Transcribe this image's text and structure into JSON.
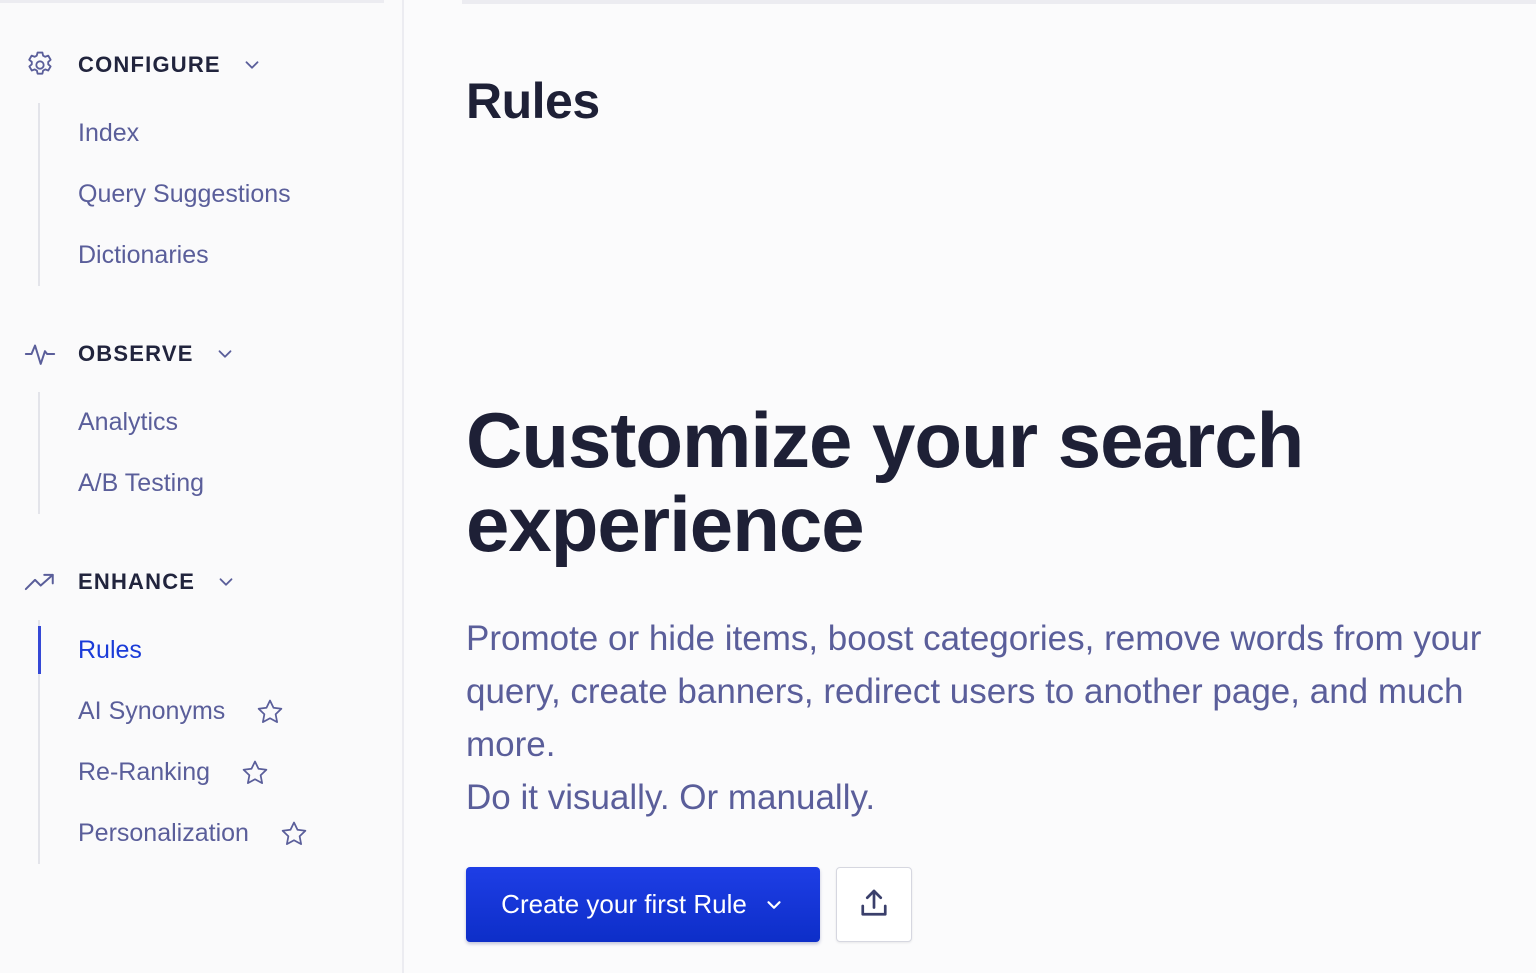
{
  "sidebar": {
    "sections": [
      {
        "title": "CONFIGURE",
        "icon": "gear-icon",
        "items": [
          {
            "label": "Index"
          },
          {
            "label": "Query Suggestions"
          },
          {
            "label": "Dictionaries"
          }
        ]
      },
      {
        "title": "OBSERVE",
        "icon": "pulse-icon",
        "items": [
          {
            "label": "Analytics"
          },
          {
            "label": "A/B Testing"
          }
        ]
      },
      {
        "title": "ENHANCE",
        "icon": "trending-up-icon",
        "items": [
          {
            "label": "Rules",
            "active": true
          },
          {
            "label": "AI Synonyms",
            "starred_icon": "star-icon"
          },
          {
            "label": "Re-Ranking",
            "starred_icon": "star-icon"
          },
          {
            "label": "Personalization",
            "starred_icon": "star-icon"
          }
        ]
      }
    ]
  },
  "main": {
    "page_title": "Rules",
    "hero_title": "Customize your search experience",
    "hero_desc_line1": "Promote or hide items, boost categories, remove words from your query, create banners, redirect users to another page, and much more.",
    "hero_desc_line2": "Do it visually. Or manually.",
    "create_button_label": "Create your first Rule",
    "upload_icon": "upload-icon"
  },
  "colors": {
    "accent": "#1a3bd8",
    "text_dark": "#1e2036",
    "text_muted": "#5a5e9a",
    "icon_color": "#5a5e9a"
  }
}
